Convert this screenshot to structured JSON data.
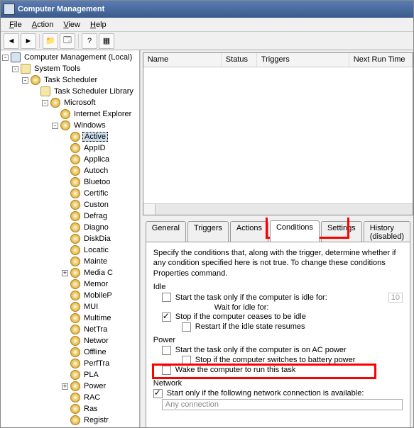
{
  "title": "Computer Management",
  "menu": {
    "file": "File",
    "action": "Action",
    "view": "View",
    "help": "Help"
  },
  "tree": [
    {
      "d": 0,
      "pm": "-",
      "icon": "root",
      "label": "Computer Management (Local)"
    },
    {
      "d": 1,
      "pm": "-",
      "icon": "fold",
      "label": "System Tools"
    },
    {
      "d": 2,
      "pm": "-",
      "icon": "clock",
      "label": "Task Scheduler"
    },
    {
      "d": 3,
      "pm": " ",
      "icon": "fold",
      "label": "Task Scheduler Library"
    },
    {
      "d": 4,
      "pm": "-",
      "icon": "clock",
      "label": "Microsoft"
    },
    {
      "d": 5,
      "pm": " ",
      "icon": "clock",
      "label": "Internet Explorer"
    },
    {
      "d": 5,
      "pm": "-",
      "icon": "clock",
      "label": "Windows"
    },
    {
      "d": 6,
      "pm": " ",
      "icon": "clock",
      "label": "Active",
      "sel": true
    },
    {
      "d": 6,
      "pm": " ",
      "icon": "clock",
      "label": "AppID"
    },
    {
      "d": 6,
      "pm": " ",
      "icon": "clock",
      "label": "Applica"
    },
    {
      "d": 6,
      "pm": " ",
      "icon": "clock",
      "label": "Autoch"
    },
    {
      "d": 6,
      "pm": " ",
      "icon": "clock",
      "label": "Bluetoo"
    },
    {
      "d": 6,
      "pm": " ",
      "icon": "clock",
      "label": "Certific"
    },
    {
      "d": 6,
      "pm": " ",
      "icon": "clock",
      "label": "Custon"
    },
    {
      "d": 6,
      "pm": " ",
      "icon": "clock",
      "label": "Defrag"
    },
    {
      "d": 6,
      "pm": " ",
      "icon": "clock",
      "label": "Diagno"
    },
    {
      "d": 6,
      "pm": " ",
      "icon": "clock",
      "label": "DiskDia"
    },
    {
      "d": 6,
      "pm": " ",
      "icon": "clock",
      "label": "Locatic"
    },
    {
      "d": 6,
      "pm": " ",
      "icon": "clock",
      "label": "Mainte"
    },
    {
      "d": 6,
      "pm": "+",
      "icon": "clock",
      "label": "Media C"
    },
    {
      "d": 6,
      "pm": " ",
      "icon": "clock",
      "label": "Memor"
    },
    {
      "d": 6,
      "pm": " ",
      "icon": "clock",
      "label": "MobileP"
    },
    {
      "d": 6,
      "pm": " ",
      "icon": "clock",
      "label": "MUI"
    },
    {
      "d": 6,
      "pm": " ",
      "icon": "clock",
      "label": "Multime"
    },
    {
      "d": 6,
      "pm": " ",
      "icon": "clock",
      "label": "NetTra"
    },
    {
      "d": 6,
      "pm": " ",
      "icon": "clock",
      "label": "Networ"
    },
    {
      "d": 6,
      "pm": " ",
      "icon": "clock",
      "label": "Offline"
    },
    {
      "d": 6,
      "pm": " ",
      "icon": "clock",
      "label": "PerfTra"
    },
    {
      "d": 6,
      "pm": " ",
      "icon": "clock",
      "label": "PLA"
    },
    {
      "d": 6,
      "pm": "+",
      "icon": "clock",
      "label": "Power"
    },
    {
      "d": 6,
      "pm": " ",
      "icon": "clock",
      "label": "RAC"
    },
    {
      "d": 6,
      "pm": " ",
      "icon": "clock",
      "label": "Ras"
    },
    {
      "d": 6,
      "pm": " ",
      "icon": "clock",
      "label": "Registr"
    }
  ],
  "cols": {
    "name": "Name",
    "status": "Status",
    "triggers": "Triggers",
    "next": "Next Run Time"
  },
  "tabs": {
    "general": "General",
    "triggers": "Triggers",
    "actions": "Actions",
    "conditions": "Conditions",
    "settings": "Settings",
    "history": "History (disabled)"
  },
  "cond": {
    "desc": "Specify the conditions that, along with the trigger, determine whether if any condition specified here is not true.  To change these conditions Properties command.",
    "idle": "Idle",
    "idle_start": "Start the task only if the computer is idle for:",
    "idle_wait": "Wait for idle for:",
    "idle_stop": "Stop if the computer ceases to be idle",
    "idle_restart": "Restart if the idle state resumes",
    "power": "Power",
    "power_ac": "Start the task only if the computer is on AC power",
    "power_batt": "Stop if the computer switches to battery power",
    "power_wake": "Wake the computer to run this task",
    "network": "Network",
    "net_start": "Start only if the following network connection is available:",
    "net_any": "Any connection",
    "num": "10"
  }
}
